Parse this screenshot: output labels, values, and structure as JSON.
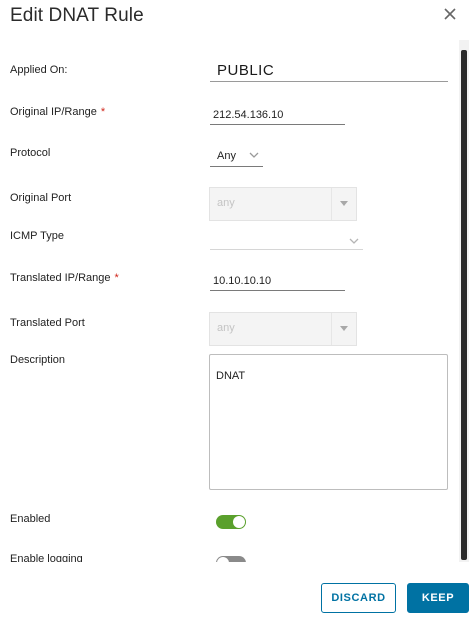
{
  "dialog": {
    "title": "Edit DNAT Rule"
  },
  "form": {
    "applied_on": {
      "label": "Applied On:",
      "value": "PUBLIC"
    },
    "original_ip": {
      "label": "Original IP/Range",
      "required_mark": "*",
      "value": "212.54.136.10"
    },
    "protocol": {
      "label": "Protocol",
      "value": "Any"
    },
    "original_port": {
      "label": "Original Port",
      "value": "any"
    },
    "icmp_type": {
      "label": "ICMP Type",
      "value": ""
    },
    "translated_ip": {
      "label": "Translated IP/Range",
      "required_mark": "*",
      "value": "10.10.10.10"
    },
    "translated_port": {
      "label": "Translated Port",
      "value": "any"
    },
    "description": {
      "label": "Description",
      "value": "DNAT"
    },
    "enabled": {
      "label": "Enabled",
      "state": "on"
    },
    "enable_logging": {
      "label": "Enable logging",
      "state": "off"
    }
  },
  "footer": {
    "discard_label": "DISCARD",
    "keep_label": "KEEP"
  },
  "colors": {
    "primary": "#0072a3",
    "toggle_on": "#5aa02c",
    "required": "#d0251a"
  }
}
